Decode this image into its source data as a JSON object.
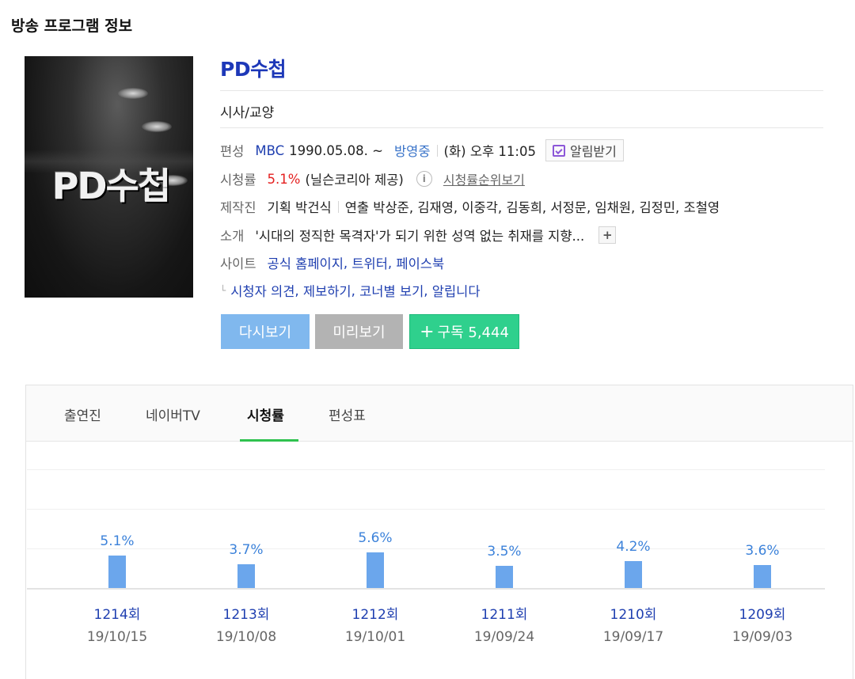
{
  "section_title": "방송 프로그램 정보",
  "poster": {
    "logo_text": "PD수첩"
  },
  "program": {
    "title": "PD수첩",
    "genre": "시사/교양"
  },
  "broadcast": {
    "label": "편성",
    "channel": "MBC",
    "date": "1990.05.08. ~",
    "status": "방영중",
    "schedule": "(화) 오후 11:05",
    "alarm_label": "알림받기"
  },
  "ratings_info": {
    "label": "시청률",
    "value": "5.1%",
    "source": "(닐슨코리아 제공)",
    "info_icon_text": "i",
    "rank_link": "시청률순위보기"
  },
  "crew": {
    "label": "제작진",
    "planning": "기획 박건식",
    "directing": "연출 박상준, 김재영, 이중각, 김동희, 서정문, 임채원, 김정민, 조철영"
  },
  "intro": {
    "label": "소개",
    "text": "'시대의 정직한 목격자'가 되기 위한 성역 없는 취재를 지향...",
    "more_icon": "+"
  },
  "site": {
    "label": "사이트",
    "links": [
      "공식 홈페이지",
      "트위터",
      "페이스북"
    ]
  },
  "sub_links": [
    "시청자 의견",
    "제보하기",
    "코너별 보기",
    "알립니다"
  ],
  "buttons": {
    "replay": "다시보기",
    "preview": "미리보기",
    "subscribe_plus": "+",
    "subscribe": "구독 5,444"
  },
  "tabs": [
    {
      "label": "출연진",
      "active": false
    },
    {
      "label": "네이버TV",
      "active": false
    },
    {
      "label": "시청률",
      "active": true
    },
    {
      "label": "편성표",
      "active": false
    }
  ],
  "colors": {
    "bar": "#6ba6ec",
    "tab_active": "#2fc24f",
    "subscribe": "#2fd08d",
    "title": "#1d38b8"
  },
  "chart_data": {
    "type": "bar",
    "categories": [
      "1214회",
      "1213회",
      "1212회",
      "1211회",
      "1210회",
      "1209회"
    ],
    "dates": [
      "19/10/15",
      "19/10/08",
      "19/10/01",
      "19/09/24",
      "19/09/17",
      "19/09/03"
    ],
    "values": [
      5.1,
      3.7,
      5.6,
      3.5,
      4.2,
      3.6
    ],
    "value_labels": [
      "5.1%",
      "3.7%",
      "5.6%",
      "3.5%",
      "4.2%",
      "3.6%"
    ],
    "ylim": [
      0,
      5.6
    ],
    "grid": true
  }
}
